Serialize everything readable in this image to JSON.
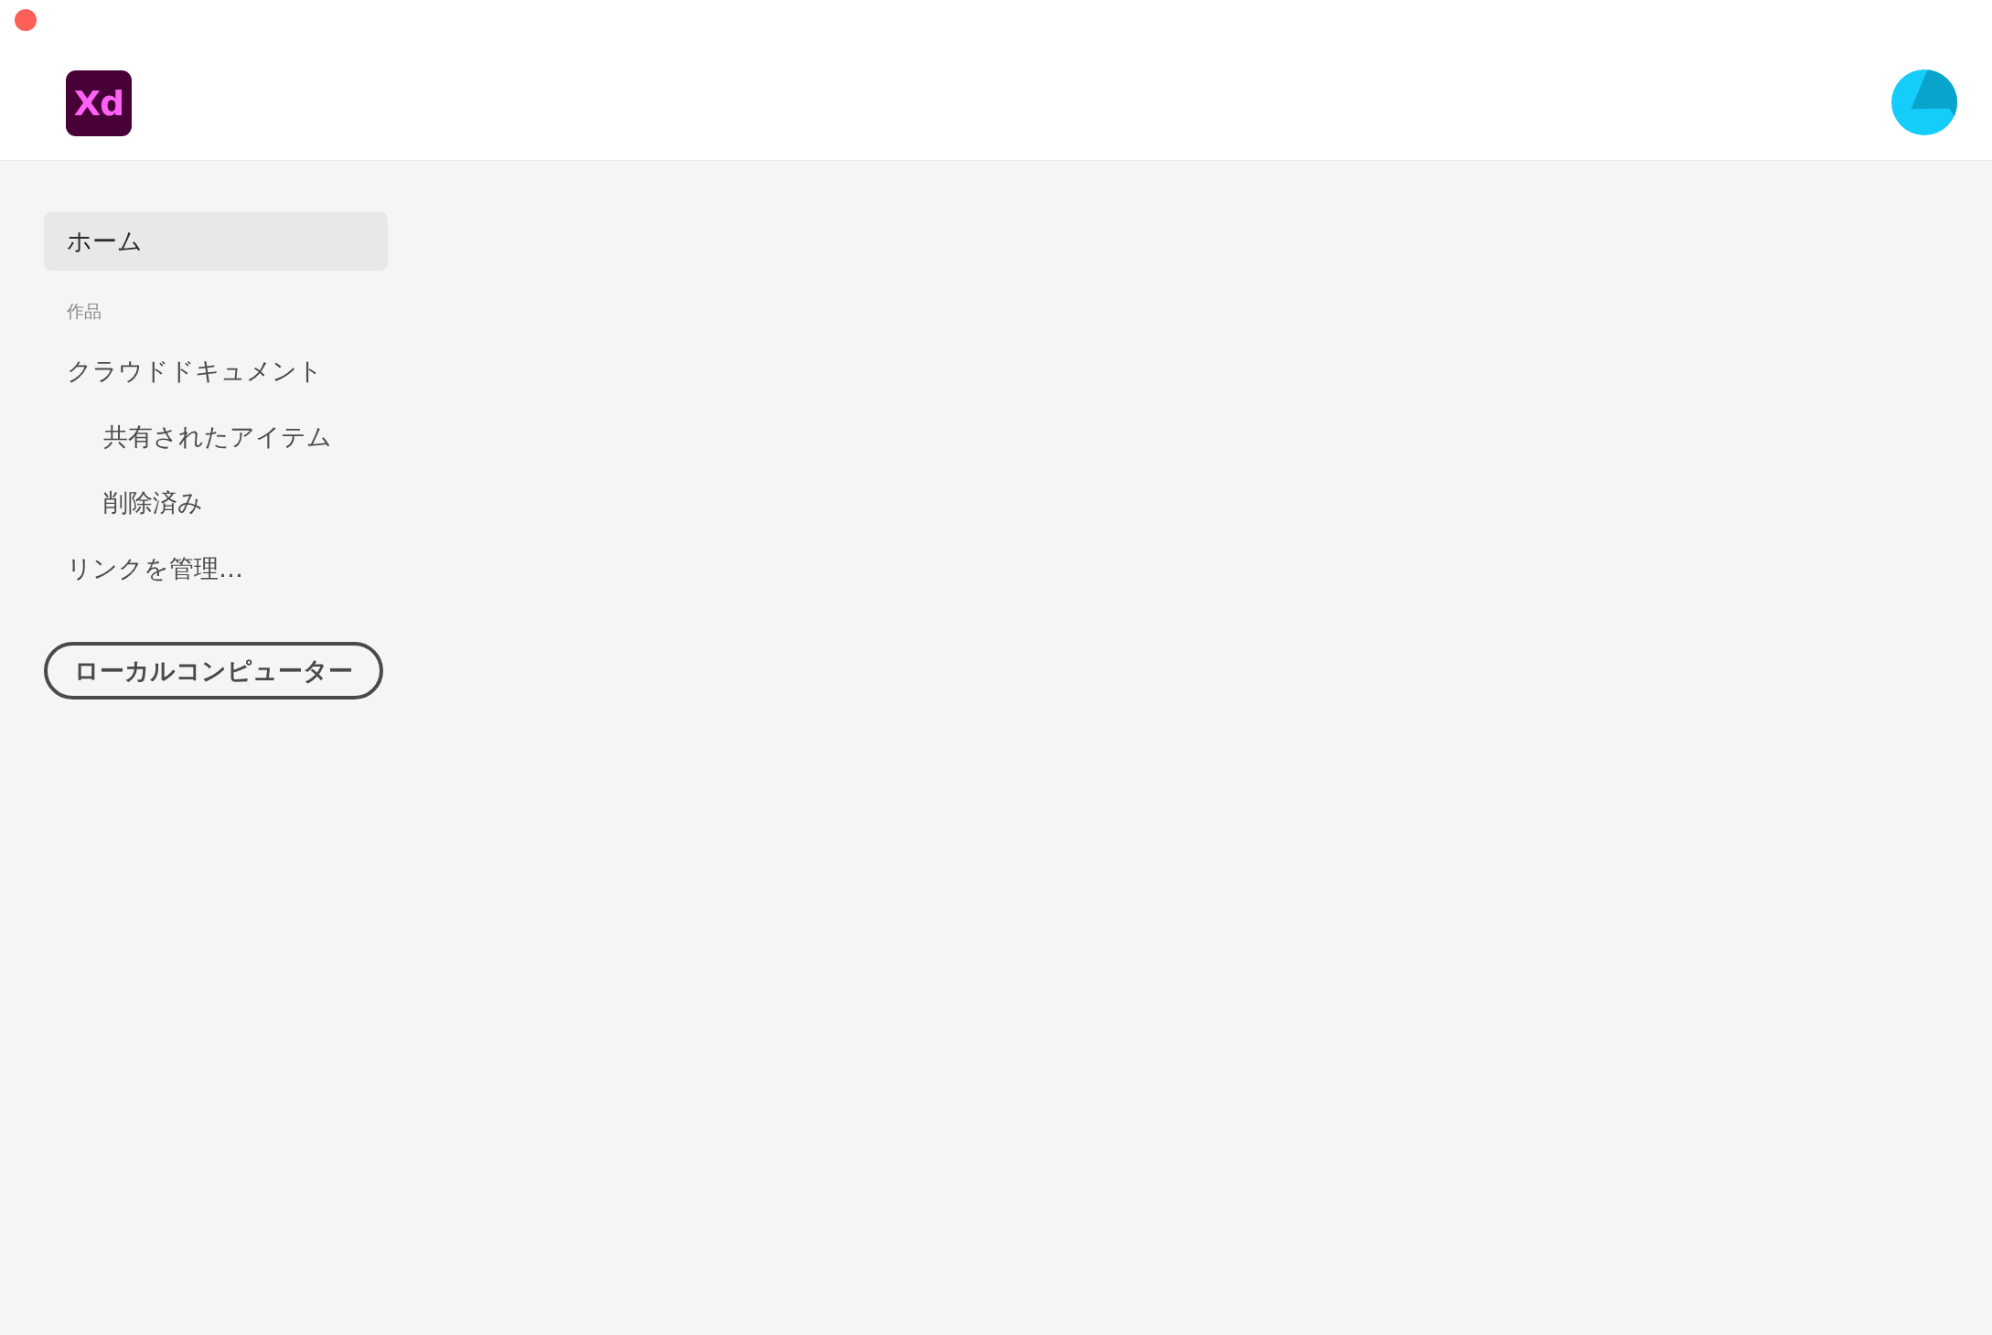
{
  "header": {
    "logo": "Xd"
  },
  "sidebar": {
    "items": [
      {
        "label": "ホーム",
        "selected": true
      }
    ],
    "sections": [
      {
        "title": "作品",
        "items": [
          {
            "label": "クラウドドキュメント",
            "selected": false,
            "children": [
              {
                "label": "共有されたアイテム",
                "selected": false
              },
              {
                "label": "削除済み",
                "selected": false
              }
            ]
          },
          {
            "label": "リンクを管理…",
            "selected": false
          }
        ]
      }
    ],
    "button": {
      "label": "ローカルコンピューター"
    }
  }
}
